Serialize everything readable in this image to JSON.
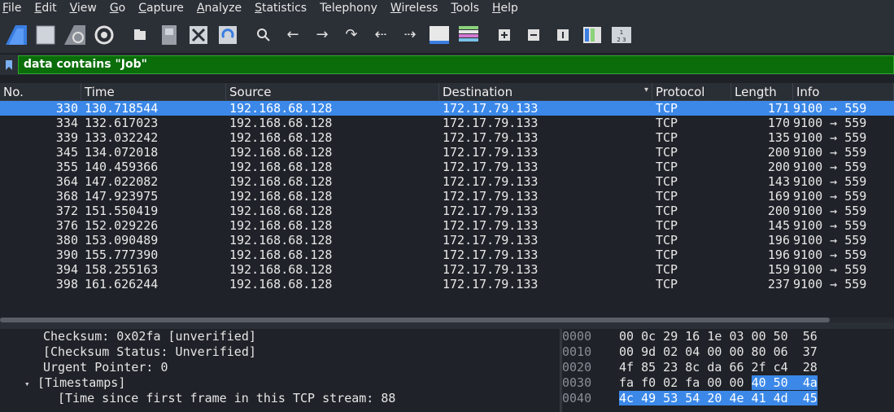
{
  "menu": [
    {
      "u": "F",
      "rest": "ile"
    },
    {
      "u": "E",
      "rest": "dit"
    },
    {
      "u": "V",
      "rest": "iew"
    },
    {
      "u": "G",
      "rest": "o"
    },
    {
      "u": "C",
      "rest": "apture"
    },
    {
      "u": "A",
      "rest": "nalyze"
    },
    {
      "u": "S",
      "rest": "tatistics"
    },
    {
      "u": "",
      "rest": "Telephony"
    },
    {
      "u": "W",
      "rest": "ireless"
    },
    {
      "u": "T",
      "rest": "ools"
    },
    {
      "u": "H",
      "rest": "elp"
    }
  ],
  "filter": {
    "value": "data contains \"Job\""
  },
  "columns": {
    "no": "No.",
    "time": "Time",
    "source": "Source",
    "destination": "Destination",
    "protocol": "Protocol",
    "length": "Length",
    "info": "Info"
  },
  "packets": [
    {
      "no": "330",
      "time": "130.718544",
      "src": "192.168.68.128",
      "dst": "172.17.79.133",
      "proto": "TCP",
      "len": "171",
      "info": "9100 → 559"
    },
    {
      "no": "334",
      "time": "132.617023",
      "src": "192.168.68.128",
      "dst": "172.17.79.133",
      "proto": "TCP",
      "len": "170",
      "info": "9100 → 559"
    },
    {
      "no": "339",
      "time": "133.032242",
      "src": "192.168.68.128",
      "dst": "172.17.79.133",
      "proto": "TCP",
      "len": "135",
      "info": "9100 → 559"
    },
    {
      "no": "345",
      "time": "134.072018",
      "src": "192.168.68.128",
      "dst": "172.17.79.133",
      "proto": "TCP",
      "len": "200",
      "info": "9100 → 559"
    },
    {
      "no": "355",
      "time": "140.459366",
      "src": "192.168.68.128",
      "dst": "172.17.79.133",
      "proto": "TCP",
      "len": "200",
      "info": "9100 → 559"
    },
    {
      "no": "364",
      "time": "147.022082",
      "src": "192.168.68.128",
      "dst": "172.17.79.133",
      "proto": "TCP",
      "len": "143",
      "info": "9100 → 559"
    },
    {
      "no": "368",
      "time": "147.923975",
      "src": "192.168.68.128",
      "dst": "172.17.79.133",
      "proto": "TCP",
      "len": "169",
      "info": "9100 → 559"
    },
    {
      "no": "372",
      "time": "151.550419",
      "src": "192.168.68.128",
      "dst": "172.17.79.133",
      "proto": "TCP",
      "len": "200",
      "info": "9100 → 559"
    },
    {
      "no": "376",
      "time": "152.029226",
      "src": "192.168.68.128",
      "dst": "172.17.79.133",
      "proto": "TCP",
      "len": "145",
      "info": "9100 → 559"
    },
    {
      "no": "380",
      "time": "153.090489",
      "src": "192.168.68.128",
      "dst": "172.17.79.133",
      "proto": "TCP",
      "len": "196",
      "info": "9100 → 559"
    },
    {
      "no": "390",
      "time": "155.777390",
      "src": "192.168.68.128",
      "dst": "172.17.79.133",
      "proto": "TCP",
      "len": "196",
      "info": "9100 → 559"
    },
    {
      "no": "394",
      "time": "158.255163",
      "src": "192.168.68.128",
      "dst": "172.17.79.133",
      "proto": "TCP",
      "len": "159",
      "info": "9100 → 559"
    },
    {
      "no": "398",
      "time": "161.626244",
      "src": "192.168.68.128",
      "dst": "172.17.79.133",
      "proto": "TCP",
      "len": "237",
      "info": "9100 → 559"
    }
  ],
  "details": [
    {
      "indent": 3,
      "tri": "",
      "text": "Checksum: 0x02fa [unverified]"
    },
    {
      "indent": 3,
      "tri": "",
      "text": "[Checksum Status: Unverified]"
    },
    {
      "indent": 3,
      "tri": "",
      "text": "Urgent Pointer: 0"
    },
    {
      "indent": 2,
      "tri": "▾",
      "text": "[Timestamps]"
    },
    {
      "indent": 5,
      "tri": "",
      "text": "[Time since first frame in this TCP stream: 88"
    }
  ],
  "bytes": [
    {
      "off": "0000",
      "plain": "00 0c 29 16 1e 03 00 50  56",
      "hl": ""
    },
    {
      "off": "0010",
      "plain": "00 9d 02 04 00 00 80 06  37",
      "hl": ""
    },
    {
      "off": "0020",
      "plain": "4f 85 23 8c da 66 2f c4  28",
      "hl": ""
    },
    {
      "off": "0030",
      "plain": "fa f0 02 fa 00 00 ",
      "hl": "40 50  4a"
    },
    {
      "off": "0040",
      "plain": "",
      "hl": "4c 49 53 54 20 4e 41 4d  45"
    }
  ]
}
